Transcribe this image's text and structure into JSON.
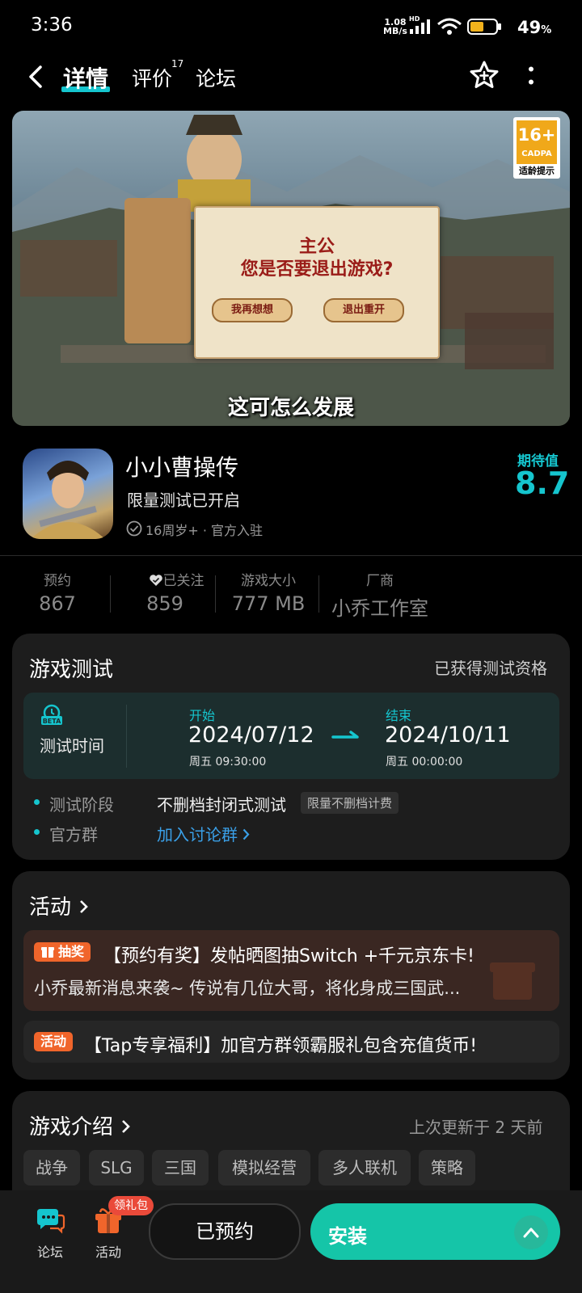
{
  "status_bar": {
    "time": "3:36",
    "net_speed_value": "1.08",
    "net_speed_unit": "MB/s",
    "network": "HD",
    "battery_value": "49",
    "battery_unit": "%"
  },
  "nav": {
    "tabs": [
      {
        "label": "详情"
      },
      {
        "label": "评价"
      },
      {
        "label": "论坛"
      }
    ],
    "review_count": "17",
    "icons": [
      "back-icon",
      "star-add-icon",
      "more-icon"
    ]
  },
  "hero": {
    "age_rating": "16+",
    "age_org": "CADPA",
    "age_note": "适龄提示",
    "dialog_title_line1": "主公",
    "dialog_title_line2": "您是否要退出游戏?",
    "dialog_btn_left": "我再想想",
    "dialog_btn_right": "退出重开",
    "caption": "这可怎么发展"
  },
  "app": {
    "name": "小小曹操传",
    "subtitle": "限量测试已开启",
    "meta": "16周岁+ · 官方入驻",
    "expectation_label": "期待值",
    "expectation_value": "8.7"
  },
  "stats": [
    {
      "label": "预约",
      "value": "867"
    },
    {
      "label": "已关注",
      "value": "859"
    },
    {
      "label": "游戏大小",
      "value": "777 MB"
    },
    {
      "label": "厂商",
      "value": "小乔工作室"
    }
  ],
  "test": {
    "title": "游戏测试",
    "status": "已获得测试资格",
    "beta_label": "BETA",
    "time_label": "测试时间",
    "start_label": "开始",
    "start_date": "2024/07/12",
    "start_time": "周五  09:30:00",
    "end_label": "结束",
    "end_date": "2024/10/11",
    "end_time": "周五  00:00:00",
    "stage_label": "测试阶段",
    "stage_value": "不删档封闭式测试",
    "stage_chip": "限量不删档计费",
    "group_label": "官方群",
    "group_link": "加入讨论群"
  },
  "activities": {
    "title": "活动",
    "items": [
      {
        "tag": "抽奖",
        "title": "【预约有奖】发帖晒图抽Switch +千元京东卡!",
        "desc": "小乔最新消息来袭~  传说有几位大哥，将化身成三国武..."
      },
      {
        "tag": "活动",
        "title": "【Tap专享福利】加官方群领霸服礼包含充值货币!"
      }
    ]
  },
  "intro": {
    "title": "游戏介绍",
    "updated": "上次更新于 2 天前",
    "tags": [
      "战争",
      "SLG",
      "三国",
      "模拟经营",
      "多人联机",
      "策略"
    ]
  },
  "bottom_bar": {
    "forum_label": "论坛",
    "activity_label": "活动",
    "gift_badge": "领礼包",
    "reserved_label": "已预约",
    "install_label": "安装"
  },
  "colors": {
    "accent": "#15c5ce",
    "install": "#15c5a8",
    "tag_orange": "#f0652b"
  }
}
